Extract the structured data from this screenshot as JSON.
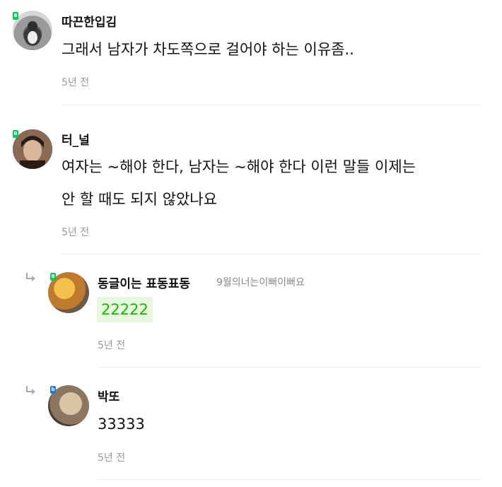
{
  "colors": {
    "accent": "#03c75a",
    "highlight_text": "#16b800",
    "highlight_bg": "#e6f8df",
    "divider": "#ebebeb"
  },
  "comments": [
    {
      "nickname": "따끈한입김",
      "badge": "B",
      "text": "그래서 남자가 차도쪽으로 걸어야 하는 이유좀..",
      "time": "5년 전",
      "icon": "avatar-penguin"
    },
    {
      "nickname": "터_널",
      "badge": "B",
      "text_lines": [
        "여자는 ~해야 한다, 남자는 ~해야 한다 이런 말들 이제는",
        "안 할 때도 되지 않았나요"
      ],
      "time": "5년 전",
      "icon": "avatar-person"
    },
    {
      "nickname": "동글이는 표동표동",
      "sub": "9월의너는이뻐이뻐요",
      "badge": "B",
      "text": "22222",
      "time": "5년 전",
      "icon": "avatar-food",
      "reply": true
    },
    {
      "nickname": "박또",
      "badge": "b",
      "text": "33333",
      "time": "5년 전",
      "icon": "avatar-dog",
      "reply": true
    }
  ]
}
